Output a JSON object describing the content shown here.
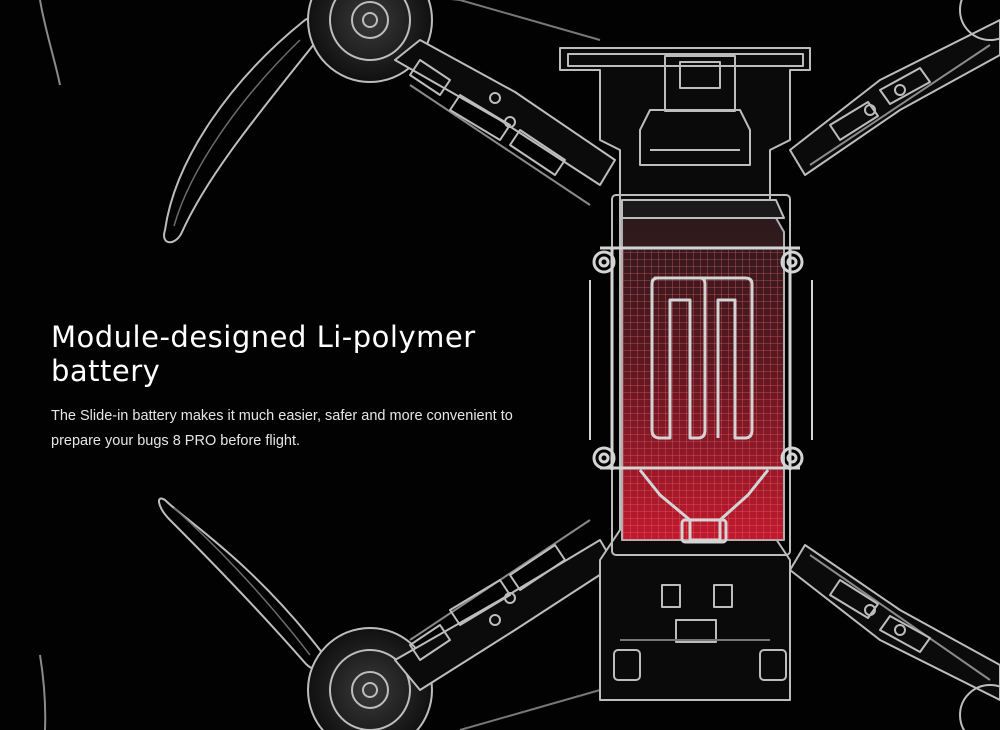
{
  "hero": {
    "headline": "Module-designed Li-polymer battery",
    "body": "The Slide-in battery makes it much easier, safer and more convenient to prepare your bugs 8 PRO before flight."
  },
  "illustration": {
    "subject": "drone-frame-blueprint",
    "battery_highlight_color": "#b3182b",
    "line_color": "#c9c9c9",
    "background_color": "#020202"
  }
}
